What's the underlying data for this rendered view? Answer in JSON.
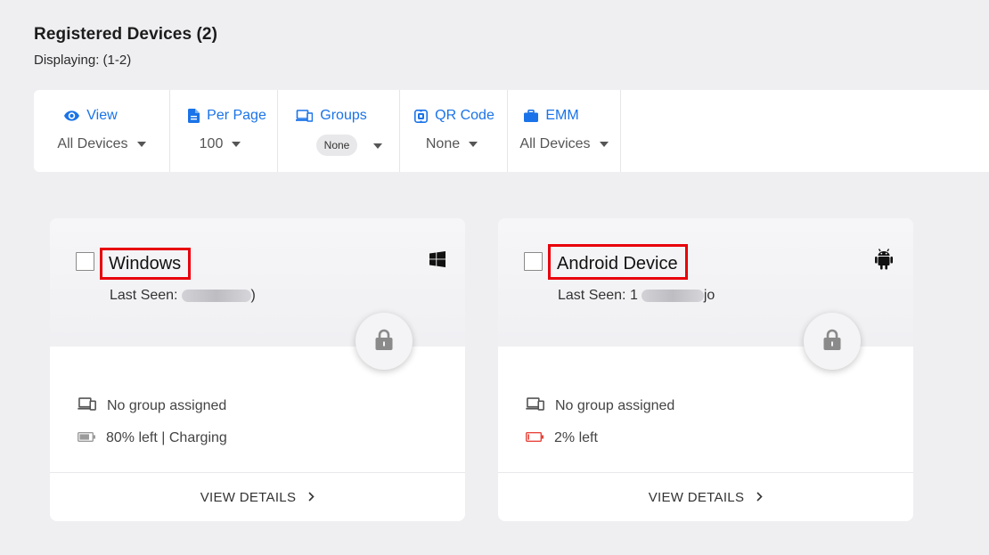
{
  "header": {
    "title": "Registered Devices (2)",
    "displaying": "Displaying: (1-2)"
  },
  "toolbar": {
    "accent_color": "#1a73e8",
    "items": [
      {
        "label": "View",
        "icon": "eye-icon",
        "value": "All Devices"
      },
      {
        "label": "Per Page",
        "icon": "document-icon",
        "value": "100"
      },
      {
        "label": "Groups",
        "icon": "devices-icon",
        "value": "None"
      },
      {
        "label": "QR Code",
        "icon": "qr-code-icon",
        "value": "None"
      },
      {
        "label": "EMM",
        "icon": "briefcase-icon",
        "value": "All Devices"
      }
    ]
  },
  "devices": [
    {
      "name": "Windows",
      "os_icon": "windows-icon",
      "last_seen_label": "Last Seen:",
      "last_seen_suffix": ")",
      "group": "No group assigned",
      "battery": "80% left | Charging",
      "battery_level": 0.8,
      "battery_color": "#9a9a9a",
      "view_details": "VIEW DETAILS"
    },
    {
      "name": "Android Device",
      "os_icon": "android-icon",
      "last_seen_label": "Last Seen: 1",
      "last_seen_suffix": "jo",
      "group": "No group assigned",
      "battery": "2% left",
      "battery_level": 0.02,
      "battery_color": "#e8453c",
      "view_details": "VIEW DETAILS"
    }
  ],
  "highlight_color": "#e8000b"
}
